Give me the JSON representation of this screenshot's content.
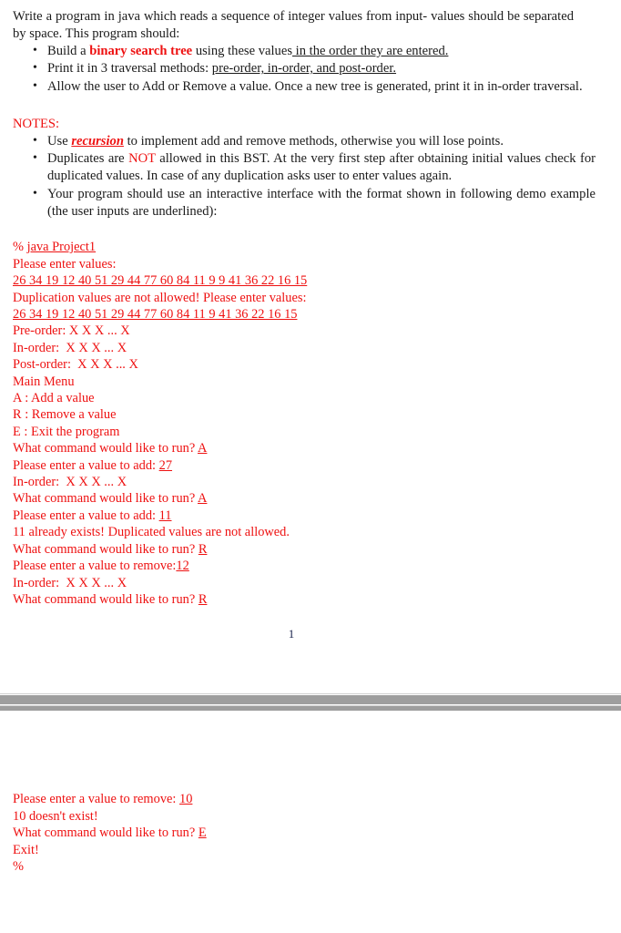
{
  "document": {
    "intro": {
      "text": "Write a program in java which reads a sequence of integer values from input- values should be separated by space. This program should:"
    },
    "requirements": [
      {
        "pre": "Build a ",
        "emphasis": "binary search tree",
        "mid": " using these values",
        "underlined": " in the order they are entered."
      },
      {
        "pre": "Print it in 3 traversal methods: ",
        "emphasis": "",
        "mid": "",
        "underlined": "pre-order, in-order, and post-order."
      },
      {
        "pre": "Allow the user to Add or Remove a value. Once a new tree is generated, print it in in-order traversal.",
        "emphasis": "",
        "mid": "",
        "underlined": ""
      }
    ],
    "notes_heading": "NOTES:",
    "notes": [
      {
        "pre": "Use ",
        "emphasis": "recursion",
        "post": " to implement add and remove methods, otherwise you will lose points."
      },
      {
        "pre": "Duplicates are ",
        "emphasis": "NOT",
        "post": " allowed in this BST. At the very first step after obtaining initial values check for duplicated values. In case of any duplication asks user to enter values again."
      },
      {
        "pre": " Your program should use an interactive interface with the format shown in following demo example (the user inputs are underlined):",
        "emphasis": "",
        "post": ""
      }
    ],
    "page_number": "1",
    "colors": {
      "console_red": "#ee1111",
      "body_text": "#1a1a1a",
      "page_number": "#16204a",
      "page_break_band": "#9e9e9e"
    }
  },
  "console_page1": {
    "lines": [
      {
        "plain": "% ",
        "input": "java Project1"
      },
      {
        "plain": "Please enter values:",
        "input": ""
      },
      {
        "plain": "",
        "input": "26 34 19 12 40 51 29 44 77 60 84 11 9 9 41 36 22 16 15"
      },
      {
        "plain": "Duplication values are not allowed! Please enter values:",
        "input": ""
      },
      {
        "plain": "",
        "input": "26 34 19 12 40 51 29 44 77 60 84 11 9 41 36 22 16 15"
      },
      {
        "plain": "Pre-order: X X X ... X",
        "input": ""
      },
      {
        "plain": "In-order:  X X X ... X",
        "input": ""
      },
      {
        "plain": "Post-order:  X X X ... X",
        "input": ""
      },
      {
        "plain": "Main Menu",
        "input": ""
      },
      {
        "plain": "A : Add a value",
        "input": ""
      },
      {
        "plain": "R : Remove a value",
        "input": ""
      },
      {
        "plain": "E : Exit the program",
        "input": ""
      },
      {
        "plain": "What command would like to run? ",
        "input": "A"
      },
      {
        "plain": "Please enter a value to add: ",
        "input": "27"
      },
      {
        "plain": "In-order:  X X X ... X",
        "input": ""
      },
      {
        "plain": "What command would like to run? ",
        "input": "A"
      },
      {
        "plain": "Please enter a value to add: ",
        "input": "11"
      },
      {
        "plain": "11 already exists! Duplicated values are not allowed.",
        "input": ""
      },
      {
        "plain": "What command would like to run? ",
        "input": "R"
      },
      {
        "plain": "Please enter a value to remove:",
        "input": "12"
      },
      {
        "plain": "In-order:  X X X ... X",
        "input": ""
      },
      {
        "plain": "What command would like to run? ",
        "input": "R"
      }
    ]
  },
  "console_page2": {
    "lines": [
      {
        "plain": "Please enter a value to remove: ",
        "input": "10"
      },
      {
        "plain": "10 doesn't exist!",
        "input": ""
      },
      {
        "plain": "What command would like to run? ",
        "input": "E"
      },
      {
        "plain": "Exit!",
        "input": ""
      },
      {
        "plain": "%",
        "input": ""
      }
    ]
  }
}
